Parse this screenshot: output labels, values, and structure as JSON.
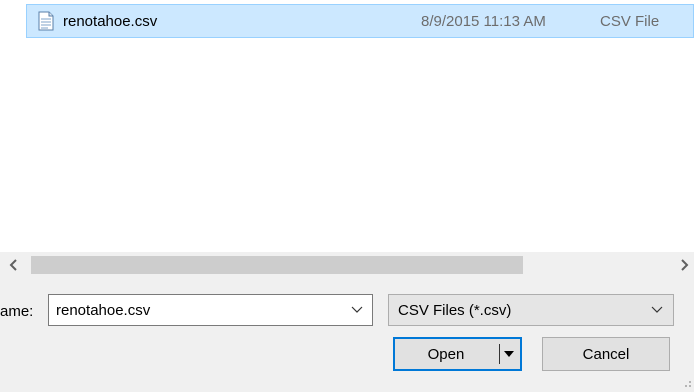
{
  "file_list": {
    "rows": [
      {
        "name": "renotahoe.csv",
        "date_modified": "8/9/2015 11:13 AM",
        "type": "CSV File",
        "icon": "text-file-icon",
        "selected": true
      }
    ]
  },
  "scrollbar": {
    "left_arrow": "‹",
    "right_arrow": "›"
  },
  "file_name": {
    "label": "ame:",
    "value": "renotahoe.csv"
  },
  "file_type": {
    "selected": "CSV Files (*.csv)"
  },
  "buttons": {
    "open": "Open",
    "cancel": "Cancel"
  },
  "colors": {
    "selection_bg": "#cce8ff",
    "selection_border": "#99d1ff",
    "default_button_border": "#0078d7",
    "dialog_bg": "#f0f0f0"
  }
}
